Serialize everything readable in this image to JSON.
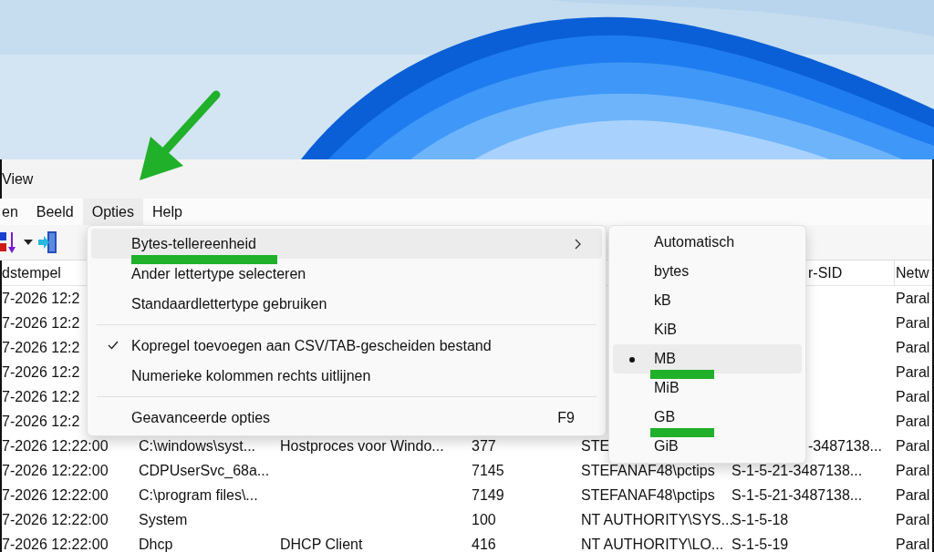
{
  "window": {
    "title": "View"
  },
  "menu_bar": [
    {
      "label": "en",
      "selected": false
    },
    {
      "label": "Beeld",
      "selected": false
    },
    {
      "label": "Opties",
      "selected": true
    },
    {
      "label": "Help",
      "selected": false
    }
  ],
  "annotation": {
    "kind": "arrow"
  },
  "menu": {
    "items": [
      {
        "kind": "item",
        "label": "Bytes-tellereenheid",
        "selected": true,
        "checked": false,
        "submenu": true,
        "marked": true
      },
      {
        "kind": "item",
        "label": "Ander lettertype selecteren",
        "selected": false,
        "checked": false,
        "submenu": false,
        "marked": false
      },
      {
        "kind": "item",
        "label": "Standaardlettertype gebruiken",
        "selected": false,
        "checked": false,
        "submenu": false,
        "marked": false
      },
      {
        "kind": "separator"
      },
      {
        "kind": "item",
        "label": "Kopregel toevoegen aan CSV/TAB-gescheiden bestand",
        "selected": false,
        "checked": true,
        "submenu": false,
        "marked": false
      },
      {
        "kind": "item",
        "label": "Numerieke kolommen rechts uitlijnen",
        "selected": false,
        "checked": false,
        "submenu": false,
        "marked": false
      },
      {
        "kind": "separator"
      },
      {
        "kind": "item",
        "label": "Geavanceerde opties",
        "shortcut": "F9",
        "selected": false,
        "checked": false,
        "submenu": false,
        "marked": false
      }
    ]
  },
  "submenu": {
    "items": [
      {
        "label": "Automatisch",
        "selected": false,
        "marked": false
      },
      {
        "label": "bytes",
        "selected": false,
        "marked": false
      },
      {
        "label": "kB",
        "selected": false,
        "marked": false
      },
      {
        "label": "KiB",
        "selected": false,
        "marked": false
      },
      {
        "label": "MB",
        "selected": true,
        "marked": true
      },
      {
        "label": "MiB",
        "selected": false,
        "marked": false
      },
      {
        "label": "GB",
        "selected": false,
        "marked": true
      },
      {
        "label": "GiB",
        "selected": false,
        "marked": false
      }
    ]
  },
  "table": {
    "header": {
      "column_1": "dstempel",
      "column_6": "r-SID",
      "column_6_clipped": true,
      "column_7": "Netw"
    },
    "rows": [
      {
        "column_1": "7-2026 12:2",
        "column_7": "Paral"
      },
      {
        "column_1": "7-2026 12:2",
        "column_7": "Paral"
      },
      {
        "column_1": "7-2026 12:2",
        "column_7": "Paral"
      },
      {
        "column_1": "7-2026 12:2",
        "column_7": "Paral"
      },
      {
        "column_1": "7-2026 12:2",
        "column_7": "Paral"
      },
      {
        "column_1": "7-2026 12:2",
        "column_7": "Paral"
      },
      {
        "column_1": "7-2026 12:22:00",
        "column_2": "C:\\windows\\syst...",
        "column_3": "Hostproces voor Windo...",
        "column_4": "377",
        "column_5": "STE",
        "column_6": "-3487138...",
        "column_6_clipped": true,
        "column_7": "Paral"
      },
      {
        "column_1": "7-2026 12:22:00",
        "column_2": "CDPUserSvc_68a...",
        "column_4": "7145",
        "column_5": "STEFANAF48\\pctips",
        "column_6": "S-1-5-21-3487138...",
        "column_6_clipped": false,
        "column_7": "Paral"
      },
      {
        "column_1": "7-2026 12:22:00",
        "column_2": "C:\\program files\\...",
        "column_4": "7149",
        "column_5": "STEFANAF48\\pctips",
        "column_6": "S-1-5-21-3487138...",
        "column_6_clipped": false,
        "column_7": "Paral"
      },
      {
        "column_1": "7-2026 12:22:00",
        "column_2": "System",
        "column_4": "100",
        "column_5": "NT AUTHORITY\\SYS...",
        "column_6": "S-1-5-18",
        "column_6_clipped": false,
        "column_7": "Paral"
      },
      {
        "column_1": "7-2026 12:22:00",
        "column_2": "Dhcp",
        "column_3": "DHCP Client",
        "column_4": "416",
        "column_5": "NT AUTHORITY\\LO...",
        "column_6": "S-1-5-19",
        "column_6_clipped": false,
        "column_7": "Paral"
      }
    ]
  }
}
